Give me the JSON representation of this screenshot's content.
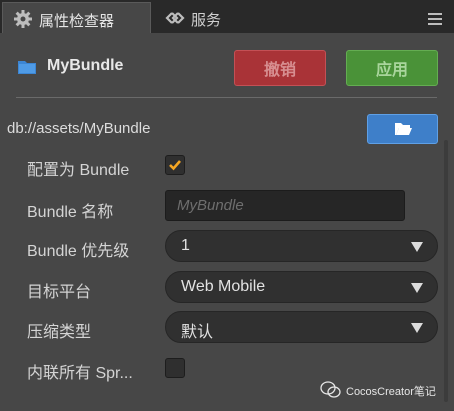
{
  "tabs": [
    {
      "label": "属性检查器",
      "icon": "gear-icon",
      "active": true
    },
    {
      "label": "服务",
      "icon": "link-icon",
      "active": false
    }
  ],
  "header": {
    "title": "MyBundle",
    "icon": "folder-icon",
    "revert_label": "撤销",
    "apply_label": "应用"
  },
  "path": "db://assets/MyBundle",
  "fields": {
    "is_bundle": {
      "label": "配置为 Bundle",
      "checked": true
    },
    "bundle_name": {
      "label": "Bundle 名称",
      "placeholder": "MyBundle",
      "value": ""
    },
    "priority": {
      "label": "Bundle 优先级",
      "value": "1"
    },
    "platform": {
      "label": "目标平台",
      "value": "Web Mobile"
    },
    "compression": {
      "label": "压缩类型",
      "value": "默认"
    },
    "inline_sprite": {
      "label": "内联所有 Spr...",
      "checked": false
    }
  },
  "watermark": "CocosCreator笔记",
  "colors": {
    "revert": "#a93337",
    "apply": "#4a9238",
    "folder_button": "#3e7fc9",
    "check": "#f5a623"
  }
}
